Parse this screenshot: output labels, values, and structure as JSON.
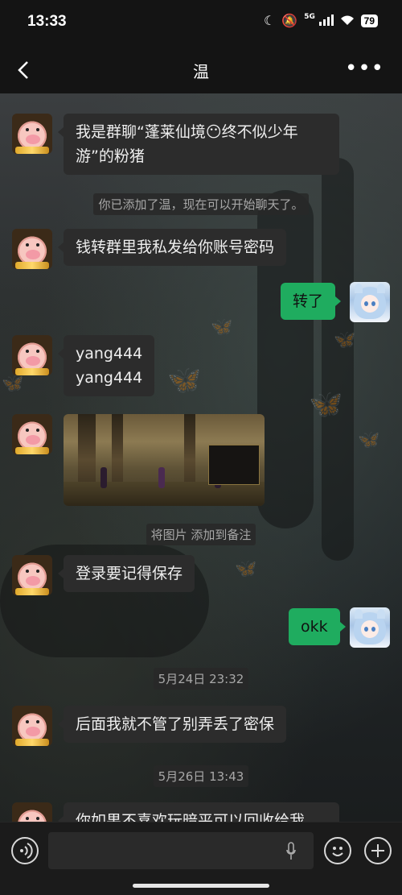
{
  "status": {
    "time": "13:33",
    "network": "5G",
    "battery": "79"
  },
  "header": {
    "title": "温",
    "more": "•••"
  },
  "messages": {
    "m1": "我是群聊“蓬莱仙境😶终不似少年游”的粉猪",
    "m1_line1": "我是群聊“蓬莱仙境😶终不似少年",
    "m1_line2": "游”的粉猪",
    "sys1": "你已添加了温，现在可以开始聊天了。",
    "m2": "钱转群里我私发给你账号密码",
    "m3_me": "转了",
    "m4_line1": "yang444",
    "m4_line2": "yang444",
    "img_note": "将图片 添加到备注",
    "m5": "登录要记得保存",
    "m6_me": "okk",
    "time1": "5月24日 23:32",
    "m7": "后面我就不管了别弄丢了密保",
    "time2": "5月26日 13:43",
    "m8_partial": "你如果不喜欢玩暗平可以回收给我"
  },
  "input": {
    "placeholder": ""
  },
  "colors": {
    "me_bubble": "#1fac5f",
    "other_bubble": "#2c2c2c",
    "bar": "#141414"
  }
}
